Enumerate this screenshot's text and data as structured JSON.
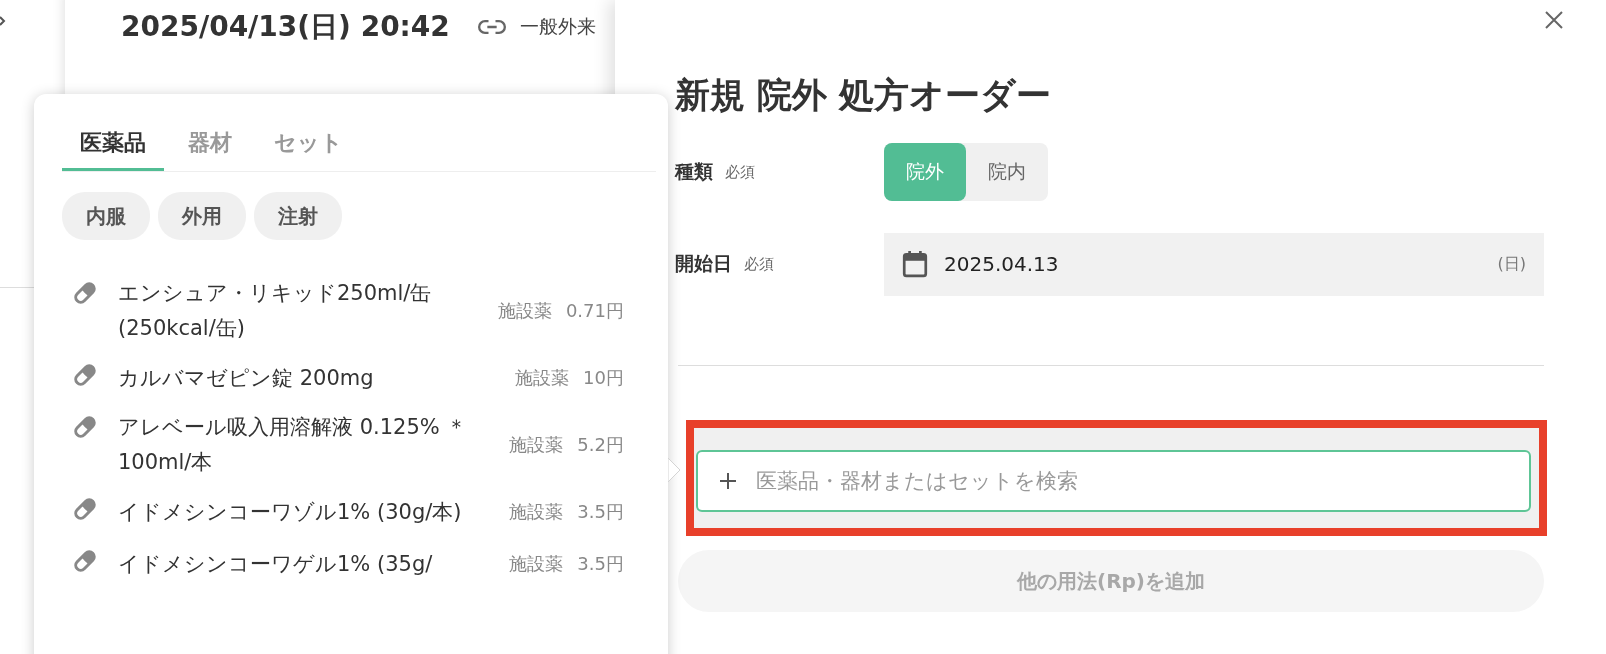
{
  "background_record": {
    "datetime": "2025/04/13(日) 20:42",
    "link_label": "一般外来"
  },
  "picker": {
    "tabs": [
      {
        "label": "医薬品",
        "selected": true
      },
      {
        "label": "器材",
        "selected": false
      },
      {
        "label": "セット",
        "selected": false
      }
    ],
    "filters": [
      {
        "label": "内服"
      },
      {
        "label": "外用"
      },
      {
        "label": "注射"
      }
    ],
    "items": [
      {
        "name": "エンシュア・リキッド250ml/缶 (250kcal/缶)",
        "source": "施設薬",
        "price": "0.71円"
      },
      {
        "name": "カルバマゼピン錠 200mg",
        "source": "施設薬",
        "price": "10円"
      },
      {
        "name": "アレベール吸入用溶解液 0.125% ＊100ml/本",
        "source": "施設薬",
        "price": "5.2円"
      },
      {
        "name": "イドメシンコーワゾル1% (30g/本)",
        "source": "施設薬",
        "price": "3.5円"
      },
      {
        "name": "イドメシンコーワゲル1% (35g/",
        "source": "施設薬",
        "price": "3.5円"
      }
    ]
  },
  "order_panel": {
    "title": "新規 院外 処方オーダー",
    "fields": [
      {
        "kind": "segmented",
        "label": "種類",
        "required": "必須",
        "options": [
          {
            "label": "院外",
            "selected": true
          },
          {
            "label": "院内",
            "selected": false
          }
        ]
      },
      {
        "kind": "date",
        "label": "開始日",
        "required": "必須",
        "value": "2025.04.13",
        "weekday": "(日)"
      }
    ],
    "search": {
      "placeholder": "医薬品・器材またはセットを検索",
      "highlighted": true
    },
    "add_rp_button": {
      "label": "他の用法(Rp)を追加",
      "disabled": true
    }
  }
}
